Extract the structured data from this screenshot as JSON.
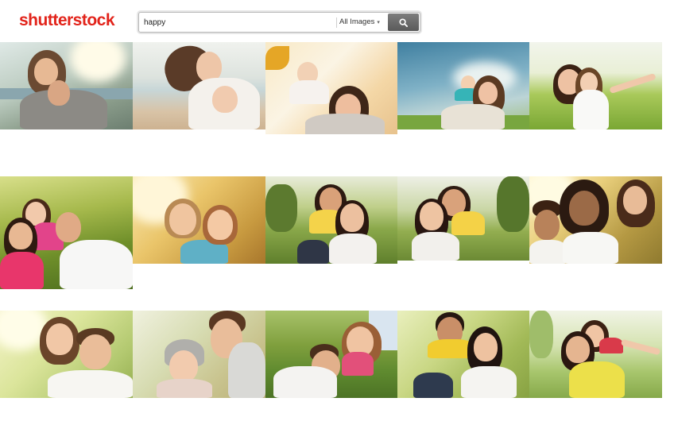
{
  "header": {
    "logo_text": "shutterstock",
    "brand_color": "#e2231a"
  },
  "search": {
    "query": "happy",
    "type_label": "All Images",
    "type_caret": "▾",
    "button_icon": "search-icon"
  },
  "results": {
    "rows": [
      [
        "couple-embracing-sunset",
        "mother-piggyback-daughter-beach",
        "daughter-on-shoulders-autumn",
        "mother-son-airplane-sky",
        "mother-daughter-field-green"
      ],
      [
        "family-piggyback-park",
        "siblings-hugging-sunlight",
        "two-women-piggyback-park",
        "two-women-laughing-park",
        "friends-group-selfie-sunny"
      ],
      [
        "couple-hug-bright",
        "couple-winter-hat-smiling",
        "couple-lying-grass",
        "couple-piggyback-yellow",
        "mother-daughter-yellow-shirt"
      ]
    ]
  }
}
